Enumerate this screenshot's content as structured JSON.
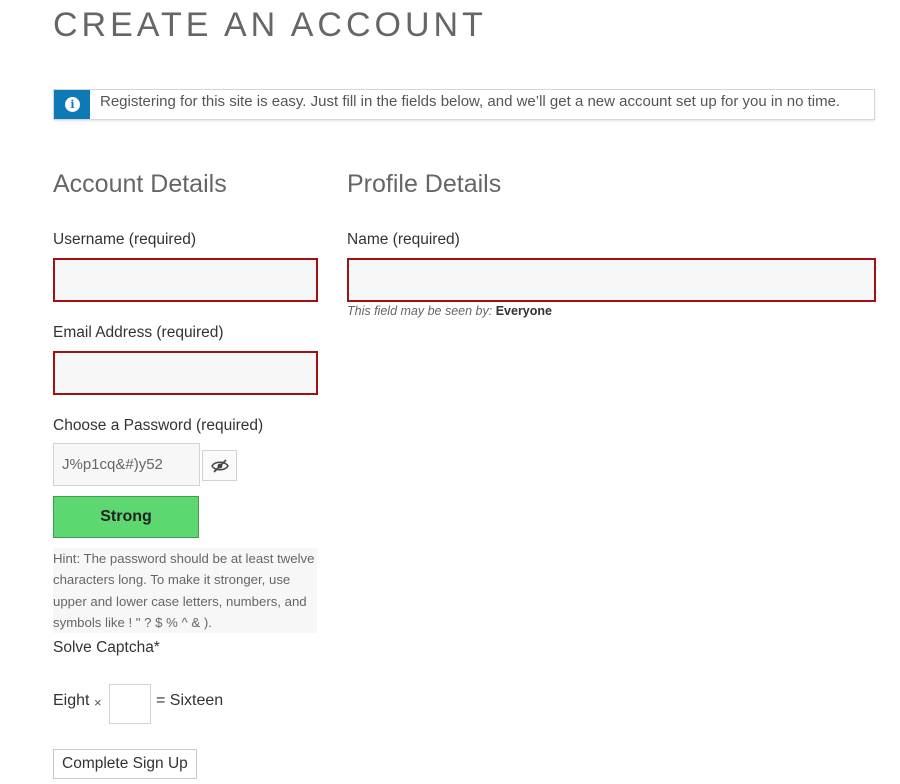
{
  "page": {
    "title": "CREATE AN ACCOUNT"
  },
  "notice": {
    "icon": "info-icon",
    "text": "Registering for this site is easy. Just fill in the fields below, and we’ll get a new account set up for you in no time."
  },
  "account_details": {
    "heading": "Account Details",
    "username_label": "Username (required)",
    "username_value": "",
    "email_label": "Email Address (required)",
    "email_value": "",
    "password_label": "Choose a Password (required)",
    "password_value": "J%p1cq&#)y52",
    "password_toggle_icon": "eye-slash-icon",
    "strength_label": "Strong",
    "hint": "Hint: The password should be at least twelve characters long. To make it stronger, use upper and lower case letters, numbers, and symbols like ! \" ? $ % ^ & )."
  },
  "profile_details": {
    "heading": "Profile Details",
    "name_label": "Name (required)",
    "name_value": "",
    "visibility_prefix": "This field may be seen by:",
    "visibility_value": "Everyone"
  },
  "captcha": {
    "label": "Solve Captcha*",
    "left_operand": "Eight",
    "operator": "×",
    "equals": "= Sixteen",
    "answer_value": ""
  },
  "submit": {
    "label": "Complete Sign Up"
  },
  "colors": {
    "accent": "#0e7ab5",
    "error_border": "#a01212",
    "strength_strong": "#5dd871"
  }
}
